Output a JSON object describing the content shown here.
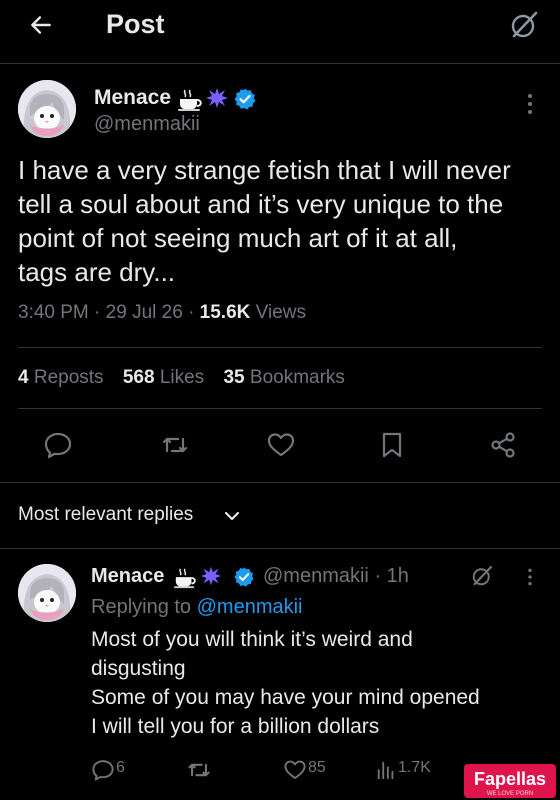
{
  "header": {
    "title": "Post",
    "back_icon": "arrow-left-icon",
    "grok_icon": "grok-icon"
  },
  "post": {
    "author_name": "Menace",
    "author_emojis": [
      "hot-beverage-emoji",
      "splat-emoji"
    ],
    "verified": true,
    "author_handle": "@menmakii",
    "text_lines": [
      "I have a very strange fetish that I will never",
      "tell a soul about and it’s very unique to the",
      "point of not seeing much art of it at all,",
      "tags are dry..."
    ],
    "time": "3:40 PM",
    "date": "29 Jul 26",
    "views_count": "15.6K",
    "views_label": "Views",
    "stats": {
      "reposts_count": "4",
      "reposts_label": "Reposts",
      "likes_count": "568",
      "likes_label": "Likes",
      "bookmarks_count": "35",
      "bookmarks_label": "Bookmarks"
    },
    "actions": [
      "reply-icon",
      "repost-icon",
      "like-icon",
      "bookmark-icon",
      "share-icon"
    ]
  },
  "replies_sort": {
    "label": "Most relevant replies"
  },
  "reply": {
    "author_name": "Menace",
    "author_handle": "@menmakii",
    "time": "1h",
    "replying_to_label": "Replying to",
    "replying_to_mention": "@menmakii",
    "text_lines": [
      "Most of you will think it’s weird and",
      "disgusting",
      "Some of you may have your mind opened",
      "I will tell you for a billion dollars"
    ],
    "reply_count": "6",
    "like_count": "85",
    "views_count": "1.7K"
  },
  "watermark": {
    "brand": "Fapellas",
    "tagline": "WE LOVE PORN"
  },
  "colors": {
    "background": "#000000",
    "text": "#e7e9ea",
    "muted": "#71767b",
    "accent": "#1d9bf0",
    "divider": "#2f3336",
    "watermark": "#e0144c"
  }
}
